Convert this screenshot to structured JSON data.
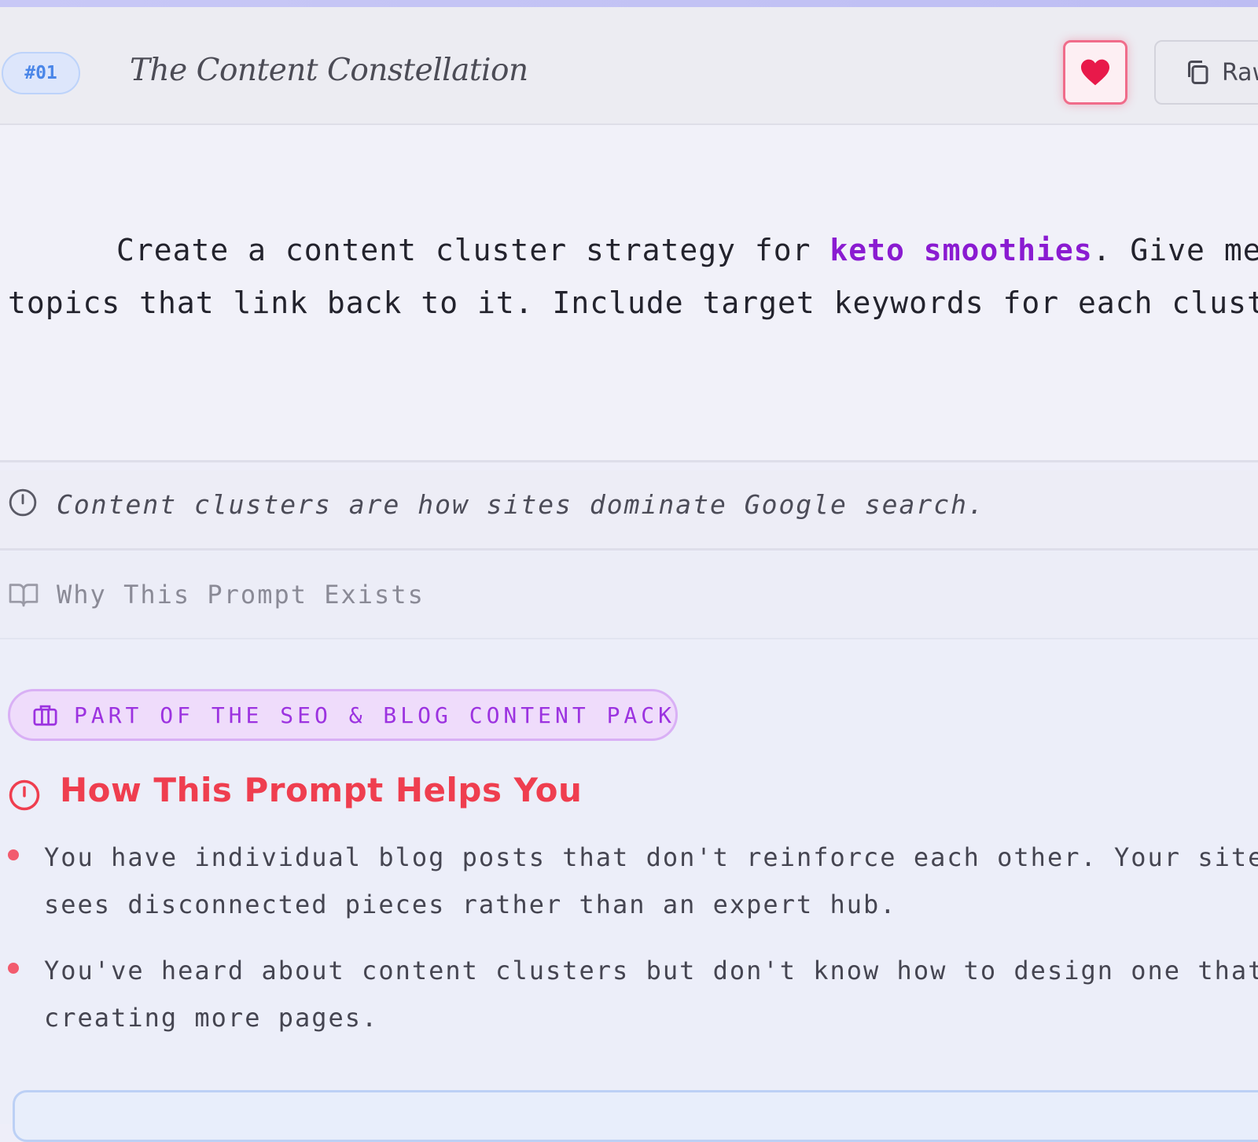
{
  "header": {
    "badge": "#01",
    "title": "The Content Constellation",
    "copy_label": "Raw"
  },
  "prompt": {
    "before": "Create a content cluster strategy for ",
    "keyword": "keto smoothies",
    "after": ". Give me",
    "line2": "topics that link back to it. Include target keywords for each cluster"
  },
  "tagline": "Content clusters are how sites dominate Google search.",
  "why_label": "Why This Prompt Exists",
  "pack_label": "PART OF THE SEO & BLOG CONTENT PACK",
  "helps": {
    "title": "How This Prompt Helps You",
    "bullets": [
      {
        "line1": "You have individual blog posts that don't reinforce each other. Your site",
        "line2": "sees disconnected pieces rather than an expert hub."
      },
      {
        "line1": "You've heard about content clusters but don't know how to design one that",
        "line2": "creating more pages."
      }
    ]
  },
  "colors": {
    "accent_purple": "#8a1bd1",
    "accent_red": "#ef3e4f",
    "badge_blue": "#4a86e8",
    "heart": "#e8194a"
  },
  "icons": [
    "heart-icon",
    "copy-icon",
    "clock-icon",
    "book-icon",
    "package-icon",
    "target-icon"
  ]
}
